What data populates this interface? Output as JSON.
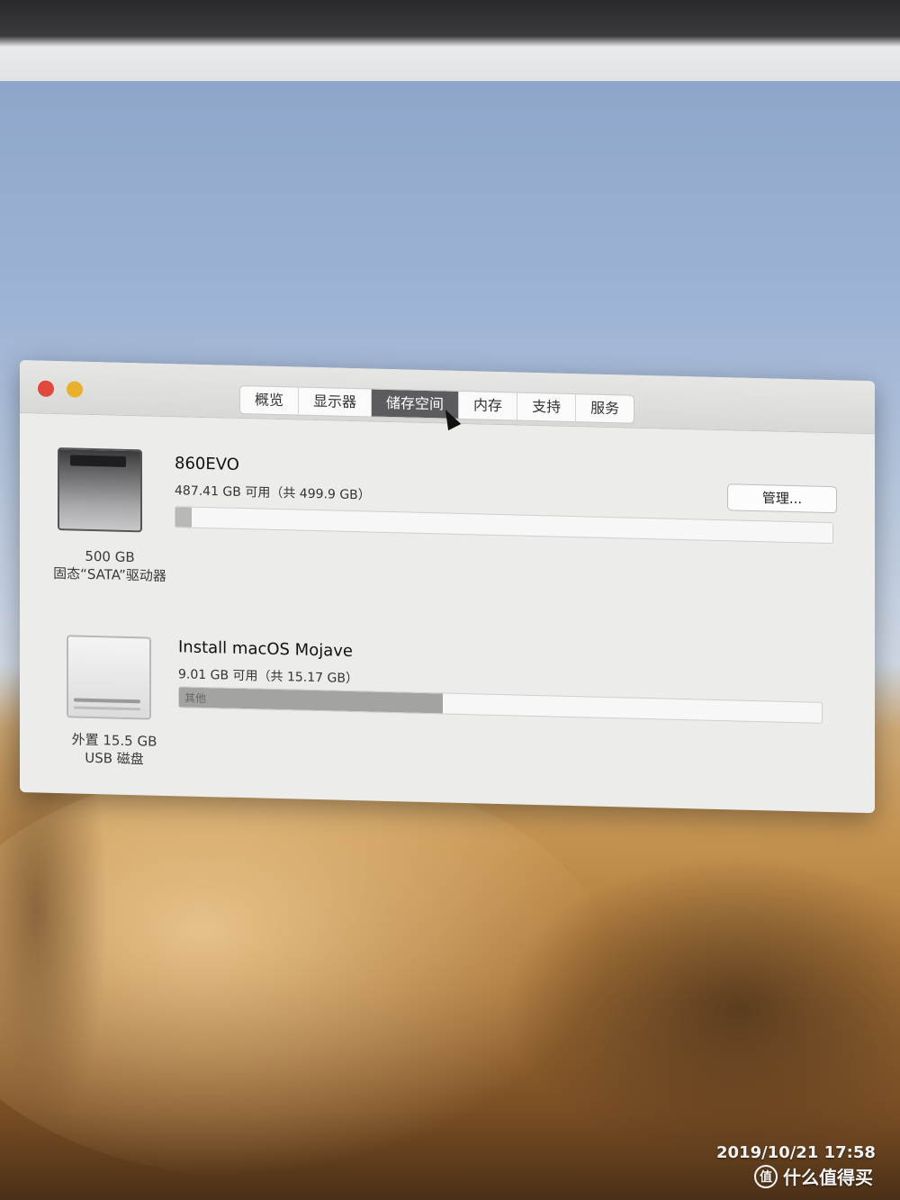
{
  "window": {
    "tabs": [
      {
        "label": "概览"
      },
      {
        "label": "显示器"
      },
      {
        "label": "储存空间"
      },
      {
        "label": "内存"
      },
      {
        "label": "支持"
      },
      {
        "label": "服务"
      }
    ],
    "active_tab": "储存空间"
  },
  "drives": [
    {
      "capacity_label": "500 GB",
      "type_label": "固态“SATA”驱动器",
      "volume_name": "860EVO",
      "availability": "487.41 GB 可用（共 499.9 GB）",
      "used_fraction": 0.025,
      "bar_text": ""
    },
    {
      "capacity_label": "外置 15.5 GB",
      "type_label": "USB 磁盘",
      "volume_name": "Install macOS Mojave",
      "availability": "9.01 GB 可用（共 15.17 GB）",
      "used_fraction": 0.41,
      "bar_text": "其他"
    }
  ],
  "manage_button": {
    "label": "管理..."
  },
  "photo_overlay": {
    "timestamp": "2019/10/21  17:58",
    "watermark": "什么值得买",
    "watermark_badge": "值"
  },
  "colors": {
    "close": "#e0483e",
    "minimize": "#e8b02c",
    "active_tab": "#5c5c60"
  }
}
